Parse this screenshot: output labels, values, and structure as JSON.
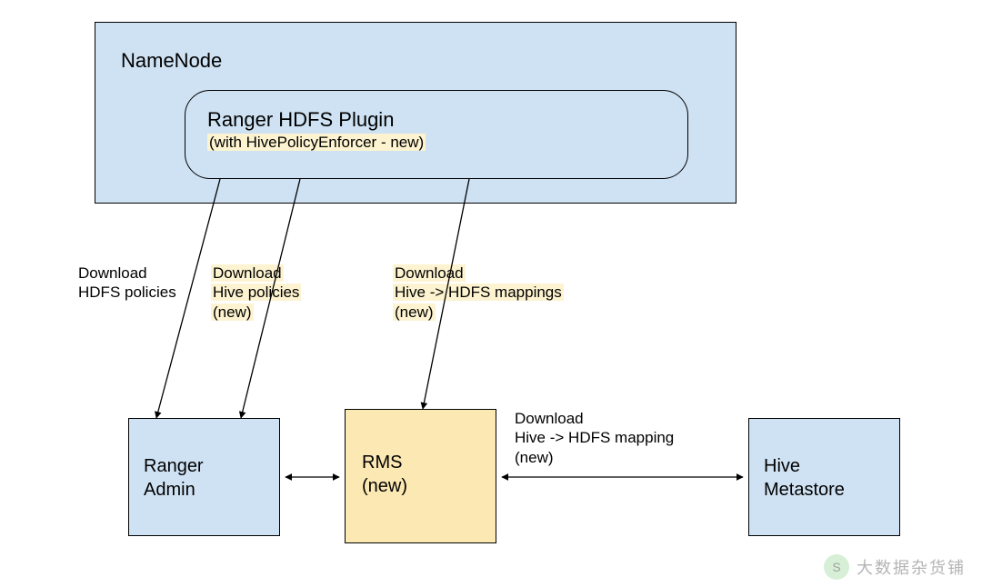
{
  "namenode": {
    "title": "NameNode"
  },
  "plugin": {
    "title": "Ranger HDFS Plugin",
    "subtitle": "(with HivePolicyEnforcer - new)"
  },
  "ranger_admin": {
    "line1": "Ranger",
    "line2": "Admin"
  },
  "rms": {
    "line1": "RMS",
    "line2": "(new)"
  },
  "hive_metastore": {
    "line1": "Hive",
    "line2": "Metastore"
  },
  "edge_hdfs_policies": {
    "line1": "Download",
    "line2": "HDFS policies"
  },
  "edge_hive_policies": {
    "line1": "Download",
    "line2": "Hive policies",
    "line3": "(new)"
  },
  "edge_hive_mappings": {
    "line1": "Download",
    "line2": "Hive -> HDFS mappings",
    "line3": "(new)"
  },
  "edge_rms_metastore": {
    "line1": "Download",
    "line2": "Hive -> HDFS mapping",
    "line3": "(new)"
  },
  "watermark": {
    "icon": "S",
    "text": "大数据杂货铺"
  }
}
